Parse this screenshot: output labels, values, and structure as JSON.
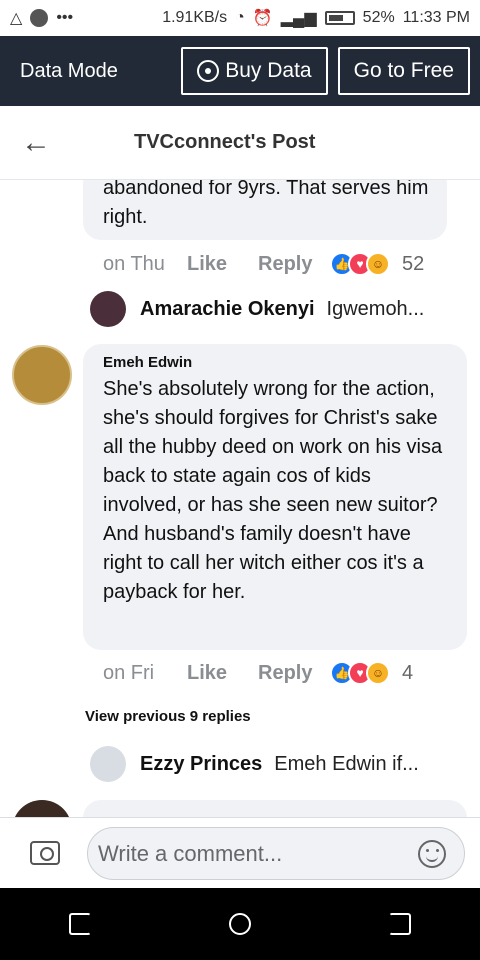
{
  "status_bar": {
    "speed": "1.91KB/s",
    "battery": "52%",
    "time": "11:33 PM"
  },
  "data_mode": {
    "title": "Data Mode",
    "buy_data": "Buy Data",
    "go_to_free": "Go to Free"
  },
  "header": {
    "title": "TVCconnect's Post"
  },
  "comments": [
    {
      "text": "abandoned for 9yrs. That serves him right.",
      "time": "on Thu",
      "like": "Like",
      "reply": "Reply",
      "reaction_count": "52"
    },
    {
      "name": "Emeh Edwin",
      "text": "She's absolutely wrong for the action, she's should forgives for Christ's sake all the hubby deed on work on his visa back to state again cos of kids involved, or has she seen new suitor? And husband's family doesn't have right to call her witch either cos it's a payback for her.",
      "time": "on Fri",
      "like": "Like",
      "reply": "Reply",
      "reaction_count": "4"
    }
  ],
  "replies": [
    {
      "name": "Amarachie Okenyi",
      "preview": "Igwemoh..."
    },
    {
      "name": "Ezzy Princes",
      "preview": "Emeh Edwin if..."
    }
  ],
  "view_previous": "View previous 9 replies",
  "composer": {
    "placeholder": "Write a comment..."
  }
}
